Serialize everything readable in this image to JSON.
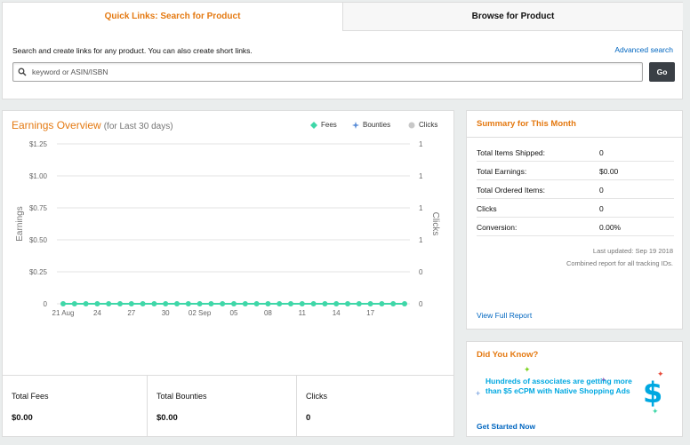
{
  "search": {
    "tab_quick": "Quick Links: Search for Product",
    "tab_browse": "Browse for Product",
    "description": "Search and create links for any product. You can also create short links.",
    "advanced_link": "Advanced search",
    "placeholder": "keyword or ASIN/ISBN",
    "go_label": "Go",
    "icon": "search-icon"
  },
  "earnings": {
    "title": "Earnings Overview",
    "subtitle": "(for Last 30 days)",
    "legend": [
      {
        "label": "Fees",
        "color": "#3fd7a8",
        "icon": "diamond"
      },
      {
        "label": "Bounties",
        "color": "#5b8ed8",
        "icon": "star"
      },
      {
        "label": "Clicks",
        "color": "#c8c8c8",
        "icon": "circle"
      }
    ],
    "footer": {
      "fees_label": "Total Fees",
      "fees_value": "$0.00",
      "bounties_label": "Total Bounties",
      "bounties_value": "$0.00",
      "clicks_label": "Clicks",
      "clicks_value": "0"
    }
  },
  "chart_data": {
    "type": "line",
    "ylabel": "Earnings",
    "y2label": "Clicks",
    "y_ticks": [
      "$1.25",
      "$1.00",
      "$0.75",
      "$0.50",
      "$0.25",
      "0"
    ],
    "y2_ticks": [
      "1",
      "1",
      "1",
      "1",
      "0",
      "0"
    ],
    "ylim": [
      0,
      1.25
    ],
    "x_tick_labels": [
      "21 Aug",
      "24",
      "27",
      "30",
      "02 Sep",
      "05",
      "08",
      "11",
      "14",
      "17"
    ],
    "series": [
      {
        "name": "Fees",
        "values": [
          0,
          0,
          0,
          0,
          0,
          0,
          0,
          0,
          0,
          0,
          0,
          0,
          0,
          0,
          0,
          0,
          0,
          0,
          0,
          0,
          0,
          0,
          0,
          0,
          0,
          0,
          0,
          0,
          0,
          0,
          0
        ]
      }
    ],
    "grid": true
  },
  "summary": {
    "title": "Summary for This Month",
    "rows": [
      {
        "label": "Total Items Shipped:",
        "value": "0"
      },
      {
        "label": "Total Earnings:",
        "value": "$0.00"
      },
      {
        "label": "Total Ordered Items:",
        "value": "0"
      },
      {
        "label": "Clicks",
        "value": "0"
      },
      {
        "label": "Conversion:",
        "value": "0.00%"
      }
    ],
    "updated": "Last updated: Sep 19 2018",
    "combined": "Combined report for all tracking IDs.",
    "view_report": "View Full Report"
  },
  "did_you_know": {
    "title": "Did You Know?",
    "text": "Hundreds of associates are getting more than $5 eCPM with Native Shopping Ads",
    "cta": "Get Started Now",
    "icon": "dollar-icon",
    "icon_glyph": "$"
  }
}
